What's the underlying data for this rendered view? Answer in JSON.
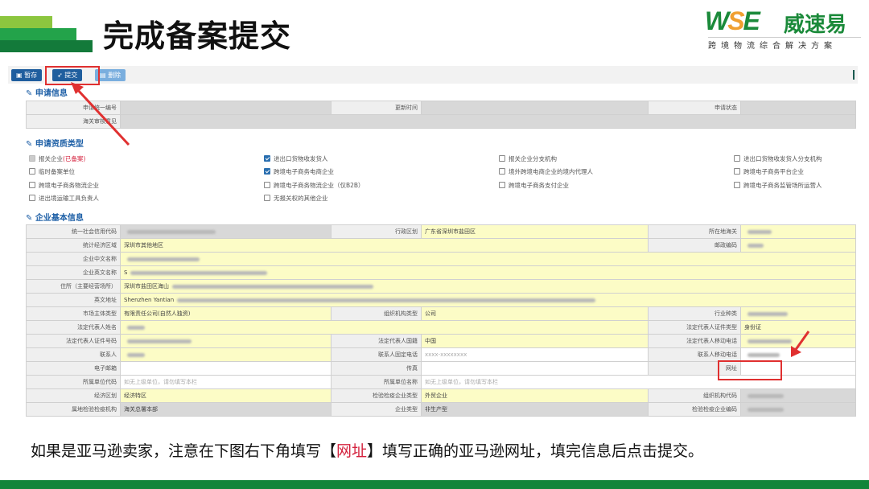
{
  "slide": {
    "title": "完成备案提交",
    "caption_parts": [
      "如果是亚马逊卖家，注意在下图右下角填写【",
      "网址",
      "】填写正确的亚马逊网址，填完信息后点击提交。"
    ]
  },
  "logo": {
    "mark": "WSE",
    "name": "威速易",
    "tagline": "跨境物流综合解决方案"
  },
  "toolbar": {
    "save": "暂存",
    "submit": "提交",
    "delete": "删除"
  },
  "sections": {
    "apply_info": "申请信息",
    "qualification": "申请资质类型",
    "basic_info": "企业基本信息"
  },
  "apply_info": {
    "apply_no": "申请统一编号",
    "update_time": "更新时间",
    "status": "申请状态",
    "customs_opinion": "海关审核意见"
  },
  "qualifications": [
    {
      "label": "报关企业",
      "suffix": "(已备案)",
      "checked": false,
      "disabled": true
    },
    {
      "label": "进出口货物收发货人",
      "checked": true
    },
    {
      "label": "报关企业分支机构",
      "checked": false
    },
    {
      "label": "进出口货物收发货人分支机构",
      "checked": false
    },
    {
      "label": "临时备案单位",
      "checked": false
    },
    {
      "label": "跨境电子商务电商企业",
      "checked": true
    },
    {
      "label": "境外跨境电商企业的境内代理人",
      "checked": false
    },
    {
      "label": "跨境电子商务平台企业",
      "checked": false
    },
    {
      "label": "跨境电子商务物流企业",
      "checked": false
    },
    {
      "label": "跨境电子商务物流企业（仅B2B）",
      "checked": false
    },
    {
      "label": "跨境电子商务支付企业",
      "checked": false
    },
    {
      "label": "跨境电子商务监管场所运营人",
      "checked": false
    },
    {
      "label": "进出境运输工具负责人",
      "checked": false
    },
    {
      "label": "无报关权的其他企业",
      "checked": false
    }
  ],
  "basic": {
    "credit_code": "统一社会信用代码",
    "admin_region": "行政区划",
    "admin_region_v": "广东省深圳市盐田区",
    "customs": "所在地海关",
    "stat_region": "统计经济区域",
    "stat_region_v": "深圳市其他地区",
    "postcode": "邮政编码",
    "cn_name": "企业中文名称",
    "en_name": "企业英文名称",
    "en_name_v": "S",
    "address": "住所（主要经营场所）",
    "address_v": "深圳市盐田区海山",
    "en_address": "英文地址",
    "en_address_v": "Shenzhen Yantian",
    "market_type": "市场主体类型",
    "market_type_v": "有限责任公司(自然人独资)",
    "org_type": "组织机构类型",
    "org_type_v": "公司",
    "industry": "行业种类",
    "legal_name": "法定代表人姓名",
    "legal_id_type": "法定代表人证件类型",
    "legal_id_type_v": "身份证",
    "legal_id_no": "法定代表人证件号码",
    "legal_nation": "法定代表人国籍",
    "legal_nation_v": "中国",
    "legal_mobile": "法定代表人移动电话",
    "contact": "联系人",
    "contact_phone": "联系人固定电话",
    "contact_phone_ph": "xxxx-xxxxxxxx",
    "contact_mobile": "联系人移动电话",
    "email": "电子邮箱",
    "fax": "传真",
    "website": "网址",
    "parent_code": "所属单位代码",
    "parent_code_ph": "如无上级单位，请勿填写本栏",
    "parent_name": "所属单位名称",
    "parent_name_ph": "如无上级单位，请勿填写本栏",
    "econ_zone": "经济区划",
    "econ_zone_v": "经济特区",
    "ciq_type": "检验检疫企业类型",
    "ciq_type_v": "外贸企业",
    "org_code": "组织机构代码",
    "ciq_org": "属地检验检疫机构",
    "ciq_org_v": "海关总署本部",
    "ent_type": "企业类型",
    "ent_type_v": "非生产型",
    "ciq_code": "检验检疫企业编码"
  },
  "colors": {
    "accent": "#1d5fa6",
    "highlight": "#e03030",
    "brand_green": "#1b8a3a"
  }
}
